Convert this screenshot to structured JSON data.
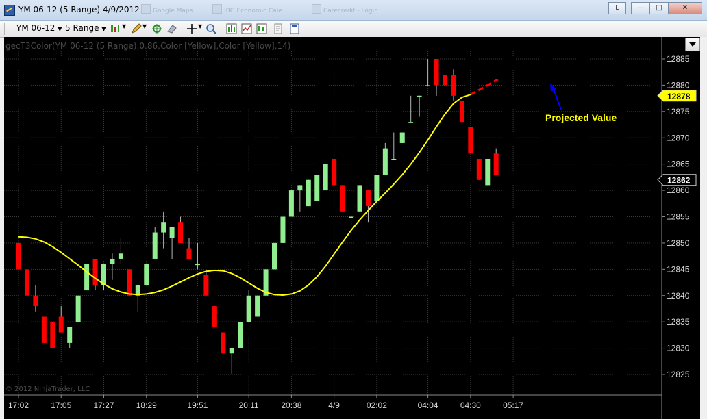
{
  "window": {
    "title": "YM 06-12 (5 Range)  4/9/2012",
    "ghost_tabs": [
      "Google Maps",
      "IBG Economic Cale...",
      "Carecredit - Login"
    ],
    "layout_button": "L",
    "minimize": "—",
    "maximize": "□",
    "close": "✕"
  },
  "toolbar": {
    "instrument": "YM 06-12",
    "period": "5 Range",
    "icons": [
      "bar-style-icon",
      "draw-pencil-icon",
      "crosshair-add-icon",
      "eraser-icon",
      "cursor-crosshair-icon",
      "zoom-icon",
      "chart-properties-icon",
      "indicators-icon",
      "strategies-icon",
      "notes-icon",
      "data-box-icon"
    ]
  },
  "colors": {
    "up": "#90ee90",
    "down": "#ff0000",
    "indicator": "#ffff00",
    "projection": "#ff0000",
    "arrow": "#0000ff",
    "grid": "#3a3a3a",
    "axis_text": "#d8d8d8",
    "price_tag_indicator": "#ffff00",
    "price_tag_last": "#000000"
  },
  "chart_data": {
    "type": "candlestick",
    "title": "gecT3Color(YM 06-12 (5 Range),0.86,Color [Yellow],Color [Yellow],14)",
    "ylim": [
      12823,
      12888
    ],
    "y_ticks": [
      12885,
      12880,
      12875,
      12870,
      12865,
      12860,
      12855,
      12850,
      12845,
      12840,
      12835,
      12830,
      12825
    ],
    "x_labels": [
      {
        "bar": 0,
        "label": "17:02"
      },
      {
        "bar": 5,
        "label": "17:05"
      },
      {
        "bar": 10,
        "label": "17:27"
      },
      {
        "bar": 15,
        "label": "18:29"
      },
      {
        "bar": 21,
        "label": "19:51"
      },
      {
        "bar": 27,
        "label": "20:11"
      },
      {
        "bar": 32,
        "label": "20:38"
      },
      {
        "bar": 37,
        "label": "4/9"
      },
      {
        "bar": 42,
        "label": "02:02"
      },
      {
        "bar": 48,
        "label": "04:04"
      },
      {
        "bar": 53,
        "label": "04:30"
      },
      {
        "bar": 58,
        "label": "05:17"
      }
    ],
    "bars": [
      {
        "o": 12850,
        "h": 12850,
        "c": 12845,
        "l": 12845
      },
      {
        "o": 12845,
        "h": 12845,
        "c": 12840,
        "l": 12840
      },
      {
        "o": 12840,
        "h": 12842,
        "c": 12838,
        "l": 12837
      },
      {
        "o": 12836,
        "h": 12836,
        "c": 12831,
        "l": 12831
      },
      {
        "o": 12835,
        "h": 12835,
        "c": 12830,
        "l": 12830
      },
      {
        "o": 12836,
        "h": 12838,
        "c": 12833,
        "l": 12833
      },
      {
        "o": 12831,
        "h": 12834,
        "c": 12834,
        "l": 12830
      },
      {
        "o": 12835,
        "h": 12840,
        "c": 12840,
        "l": 12835
      },
      {
        "o": 12841,
        "h": 12846,
        "c": 12846,
        "l": 12841
      },
      {
        "o": 12847,
        "h": 12847,
        "c": 12842,
        "l": 12841
      },
      {
        "o": 12842,
        "h": 12846,
        "c": 12846,
        "l": 12841
      },
      {
        "o": 12846,
        "h": 12848,
        "c": 12847,
        "l": 12843
      },
      {
        "o": 12847,
        "h": 12851,
        "c": 12848,
        "l": 12846
      },
      {
        "o": 12845,
        "h": 12845,
        "c": 12840,
        "l": 12840
      },
      {
        "o": 12840,
        "h": 12842,
        "c": 12842,
        "l": 12837
      },
      {
        "o": 12842,
        "h": 12846,
        "c": 12846,
        "l": 12842
      },
      {
        "o": 12847,
        "h": 12853,
        "c": 12852,
        "l": 12847
      },
      {
        "o": 12852,
        "h": 12856,
        "c": 12854,
        "l": 12849
      },
      {
        "o": 12851,
        "h": 12853,
        "c": 12853,
        "l": 12847
      },
      {
        "o": 12854,
        "h": 12855,
        "c": 12850,
        "l": 12850
      },
      {
        "o": 12849,
        "h": 12851,
        "c": 12847,
        "l": 12847
      },
      {
        "o": 12846,
        "h": 12850,
        "c": 12846,
        "l": 12845
      },
      {
        "o": 12844,
        "h": 12845,
        "c": 12840,
        "l": 12840
      },
      {
        "o": 12838,
        "h": 12838,
        "c": 12834,
        "l": 12834
      },
      {
        "o": 12833,
        "h": 12833,
        "c": 12829,
        "l": 12829
      },
      {
        "o": 12829,
        "h": 12830,
        "c": 12830,
        "l": 12825
      },
      {
        "o": 12830,
        "h": 12835,
        "c": 12835,
        "l": 12830
      },
      {
        "o": 12835,
        "h": 12841,
        "c": 12840,
        "l": 12835
      },
      {
        "o": 12836,
        "h": 12840,
        "c": 12840,
        "l": 12836
      },
      {
        "o": 12840,
        "h": 12845,
        "c": 12845,
        "l": 12840
      },
      {
        "o": 12845,
        "h": 12850,
        "c": 12850,
        "l": 12845
      },
      {
        "o": 12850,
        "h": 12855,
        "c": 12855,
        "l": 12850
      },
      {
        "o": 12855,
        "h": 12860,
        "c": 12860,
        "l": 12855
      },
      {
        "o": 12860,
        "h": 12861,
        "c": 12861,
        "l": 12856
      },
      {
        "o": 12857,
        "h": 12862,
        "c": 12862,
        "l": 12857
      },
      {
        "o": 12858,
        "h": 12863,
        "c": 12863,
        "l": 12858
      },
      {
        "o": 12860,
        "h": 12865,
        "c": 12865,
        "l": 12860
      },
      {
        "o": 12866,
        "h": 12866,
        "c": 12861,
        "l": 12861
      },
      {
        "o": 12861,
        "h": 12861,
        "c": 12856,
        "l": 12856
      },
      {
        "o": 12855,
        "h": 12855,
        "c": 12855,
        "l": 12853
      },
      {
        "o": 12856,
        "h": 12861,
        "c": 12861,
        "l": 12856
      },
      {
        "o": 12860,
        "h": 12860,
        "c": 12857,
        "l": 12854
      },
      {
        "o": 12858,
        "h": 12863,
        "c": 12863,
        "l": 12858
      },
      {
        "o": 12863,
        "h": 12869,
        "c": 12868,
        "l": 12863
      },
      {
        "o": 12866,
        "h": 12871,
        "c": 12866,
        "l": 12866
      },
      {
        "o": 12869,
        "h": 12871,
        "c": 12871,
        "l": 12869
      },
      {
        "o": 12873,
        "h": 12878,
        "c": 12873,
        "l": 12873
      },
      {
        "o": 12878,
        "h": 12878,
        "c": 12878,
        "l": 12874
      },
      {
        "o": 12880,
        "h": 12885,
        "c": 12880,
        "l": 12880
      },
      {
        "o": 12885,
        "h": 12885,
        "c": 12880,
        "l": 12878
      },
      {
        "o": 12882,
        "h": 12883,
        "c": 12880,
        "l": 12877
      },
      {
        "o": 12882,
        "h": 12883,
        "c": 12878,
        "l": 12877
      },
      {
        "o": 12877,
        "h": 12877,
        "c": 12873,
        "l": 12873
      },
      {
        "o": 12872,
        "h": 12872,
        "c": 12867,
        "l": 12867
      },
      {
        "o": 12866,
        "h": 12866,
        "c": 12862,
        "l": 12862
      },
      {
        "o": 12861,
        "h": 12866,
        "c": 12866,
        "l": 12861
      },
      {
        "o": 12867,
        "h": 12868,
        "c": 12863,
        "l": 12863
      }
    ],
    "indicator": {
      "name": "gecT3Color",
      "values": [
        12851.2,
        12851.1,
        12850.8,
        12850.2,
        12849.3,
        12848.2,
        12847.0,
        12845.8,
        12844.5,
        12843.3,
        12842.2,
        12841.3,
        12840.7,
        12840.3,
        12840.2,
        12840.3,
        12840.6,
        12841.1,
        12841.8,
        12842.6,
        12843.4,
        12844.1,
        12844.6,
        12844.8,
        12844.7,
        12844.2,
        12843.4,
        12842.4,
        12841.4,
        12840.6,
        12840.2,
        12840.1,
        12840.3,
        12840.9,
        12842.0,
        12843.6,
        12845.6,
        12847.9,
        12850.2,
        12852.4,
        12854.4,
        12856.2,
        12857.9,
        12859.5,
        12861.2,
        12863.0,
        12865.0,
        12867.2,
        12869.6,
        12872.1,
        12874.5,
        12876.5,
        12877.7,
        12878.2
      ],
      "last_value": 12878
    },
    "projection": {
      "from": {
        "bar": 53,
        "value": 12878.2
      },
      "to": {
        "bar": 56.2,
        "value": 12881.1
      }
    },
    "last_price": 12862,
    "annotation": "Projected Value"
  },
  "copyright": "© 2012 NinjaTrader, LLC"
}
